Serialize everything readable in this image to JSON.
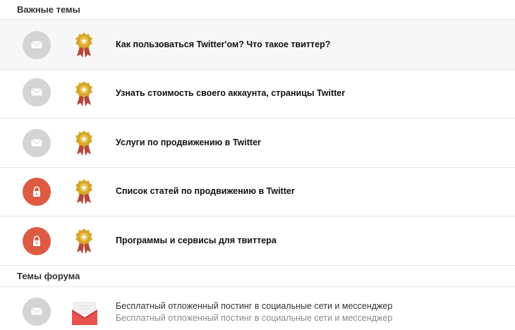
{
  "sections": {
    "important": {
      "label": "Важные темы"
    },
    "forum": {
      "label": "Темы форума"
    }
  },
  "important_topics": [
    {
      "title": "Как пользоваться Twitter'ом? Что такое твиттер?",
      "status_icon": "envelope-icon",
      "status_color": "#d4d4d4",
      "badge_icon": "award-ribbon-icon"
    },
    {
      "title": "Узнать стоимость своего аккаунта, страницы Twitter",
      "status_icon": "envelope-icon",
      "status_color": "#d4d4d4",
      "badge_icon": "award-ribbon-icon"
    },
    {
      "title": "Услуги по продвижению в Twitter",
      "status_icon": "envelope-icon",
      "status_color": "#d4d4d4",
      "badge_icon": "award-ribbon-icon"
    },
    {
      "title": "Список статей по продвижению в Twitter",
      "status_icon": "lock-icon",
      "status_color": "#df5a43",
      "badge_icon": "award-ribbon-icon"
    },
    {
      "title": "Программы и сервисы для твиттера",
      "status_icon": "lock-icon",
      "status_color": "#df5a43",
      "badge_icon": "award-ribbon-icon"
    }
  ],
  "forum_topics": [
    {
      "title": "Бесплатный отложенный постинг в социальные сети и мессенджер",
      "subtitle": "Бесплатный отложенный постинг в социальные сети и мессенджер",
      "status_icon": "envelope-icon",
      "type_icon": "red-envelope-icon",
      "accent_color": "#e8534f"
    }
  ]
}
